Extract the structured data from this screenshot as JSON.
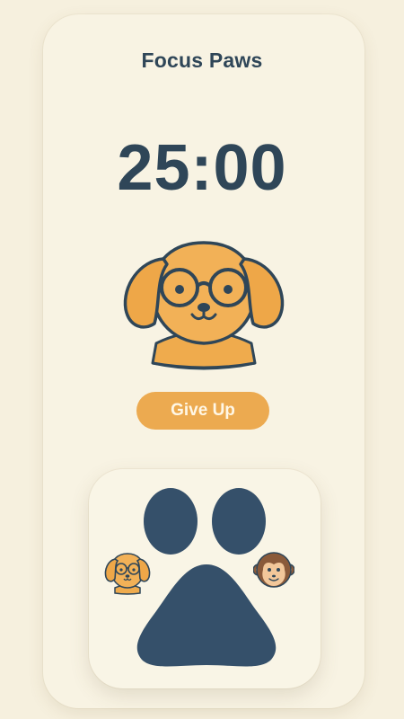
{
  "app": {
    "title": "Focus Paws"
  },
  "timer": {
    "display": "25:00"
  },
  "mascot": {
    "icon": "dog-with-glasses-icon"
  },
  "actions": {
    "give_up_label": "Give Up"
  },
  "widget": {
    "paw_icon": "paw-icon",
    "avatars": [
      {
        "icon": "dog-avatar-icon"
      },
      {
        "icon": "monkey-avatar-icon"
      }
    ]
  },
  "colors": {
    "background": "#f6f0de",
    "text_primary": "#2f4658",
    "accent_orange": "#ecaa50",
    "paw_navy": "#35506a",
    "monkey_brown": "#8a5a3a"
  }
}
